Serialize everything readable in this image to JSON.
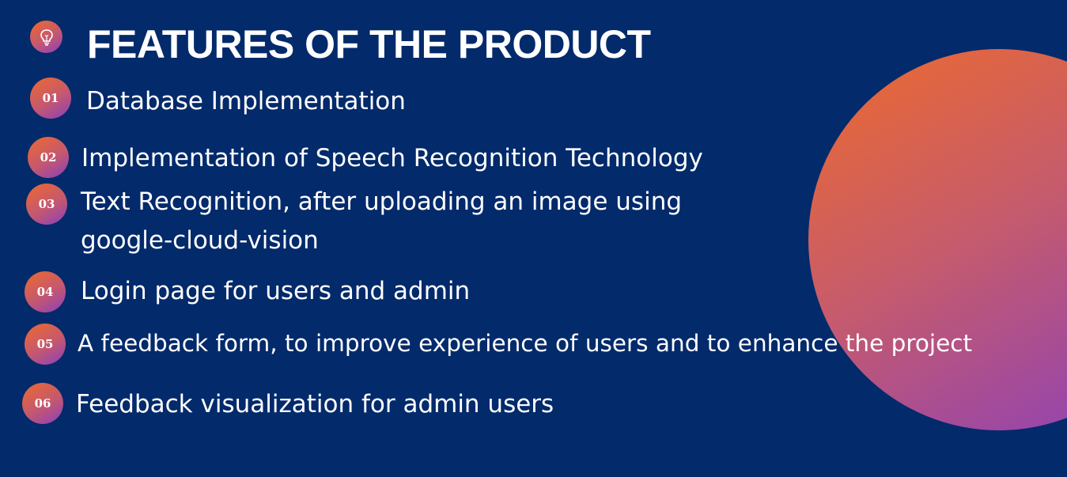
{
  "title": "FEATURES OF THE PRODUCT",
  "title_icon": "lightbulb-icon",
  "colors": {
    "background": "#032a6b",
    "gradient_start": "#ee6a2c",
    "gradient_end": "#8a3fbd",
    "text": "#ffffff"
  },
  "features": [
    {
      "number": "01",
      "text": "Database Implementation"
    },
    {
      "number": "02",
      "text": "Implementation of Speech Recognition Technology"
    },
    {
      "number": "03",
      "text_line1": "Text Recognition, after uploading an image using",
      "text_line2": "google-cloud-vision"
    },
    {
      "number": "04",
      "text": "Login page for users and admin"
    },
    {
      "number": "05",
      "text": "A feedback form, to improve experience of users and to enhance the project"
    },
    {
      "number": "06",
      "text": "Feedback visualization for admin users"
    }
  ]
}
